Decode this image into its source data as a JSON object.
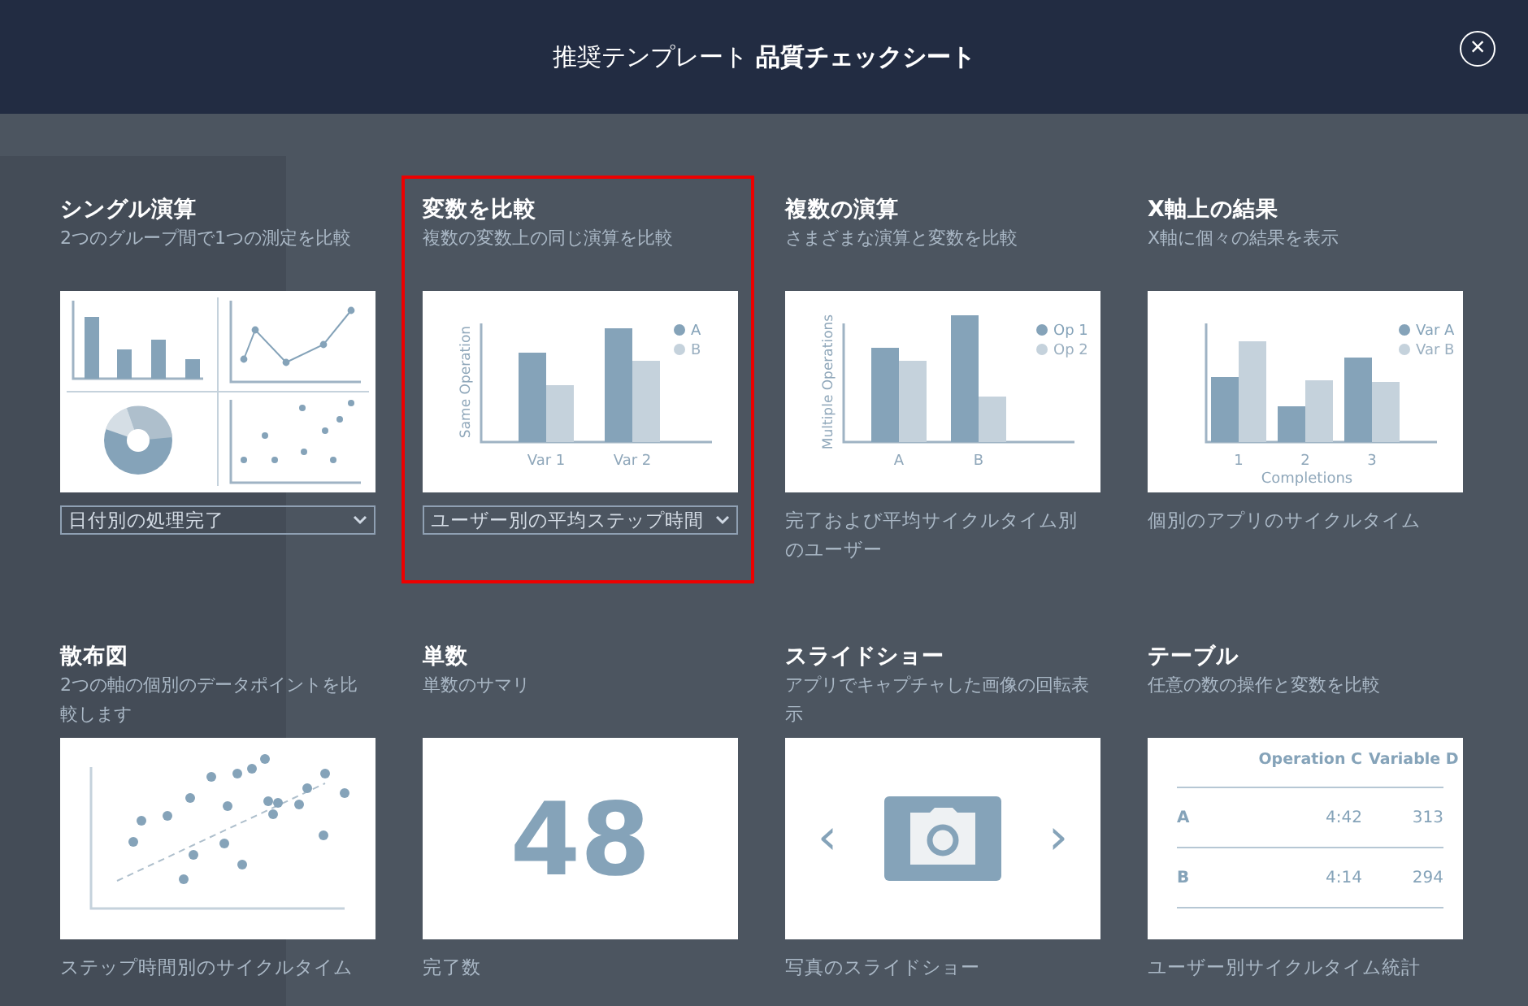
{
  "dialog": {
    "title": "推奨テンプレート **品質チェックシート**",
    "close": "×"
  },
  "templates": [
    {
      "title": "シングル演算",
      "description": "2つのグループ間で1つの測定を比較",
      "selected": false,
      "preview": {
        "kind": "quad"
      },
      "footer": {
        "kind": "dropdown",
        "text": "日付別の処理完了"
      }
    },
    {
      "title": "変数を比較",
      "description": "複数の変数上の同じ演算を比較",
      "selected": true,
      "preview": {
        "kind": "grouped-bar",
        "ylabel": "Same Operation",
        "legend": [
          "A",
          "B"
        ],
        "categories": [
          "Var 1",
          "Var 2"
        ]
      },
      "footer": {
        "kind": "dropdown",
        "text": "ユーザー別の平均ステップ時間"
      }
    },
    {
      "title": "複数の演算",
      "description": "さまざまな演算と変数を比較",
      "selected": false,
      "preview": {
        "kind": "grouped-bar",
        "ylabel": "Multiple Operations",
        "legend": [
          "Op 1",
          "Op 2"
        ],
        "categories": [
          "A",
          "B"
        ]
      },
      "footer": {
        "kind": "caption",
        "text": "完了および平均サイクルタイム別のユーザー"
      }
    },
    {
      "title": "X軸上の結果",
      "description": "X軸に個々の結果を表示",
      "selected": false,
      "preview": {
        "kind": "grouped-bar",
        "xlabel": "Completions",
        "legend": [
          "Var A",
          "Var B"
        ],
        "categories": [
          "1",
          "2",
          "3"
        ]
      },
      "footer": {
        "kind": "caption",
        "text": "個別のアプリのサイクルタイム"
      }
    },
    {
      "title": "散布図",
      "description": "2つの軸の個別のデータポイントを比較します",
      "selected": false,
      "preview": {
        "kind": "scatter"
      },
      "footer": {
        "kind": "caption",
        "text": "ステップ時間別のサイクルタイム"
      }
    },
    {
      "title": "単数",
      "description": "単数のサマリ",
      "selected": false,
      "preview": {
        "kind": "number",
        "value": "48"
      },
      "footer": {
        "kind": "caption",
        "text": "完了数"
      }
    },
    {
      "title": "スライドショー",
      "description": "アプリでキャプチャした画像の回転表示",
      "selected": false,
      "preview": {
        "kind": "slideshow",
        "prev": "‹",
        "next": "›"
      },
      "footer": {
        "kind": "caption",
        "text": "写真のスライドショー"
      }
    },
    {
      "title": "テーブル",
      "description": "任意の数の操作と変数を比較",
      "selected": false,
      "preview": {
        "kind": "table",
        "columns": [
          "",
          "Operation C",
          "Variable D"
        ],
        "rows": [
          [
            "A",
            "4:42",
            "313"
          ],
          [
            "B",
            "4:14",
            "294"
          ]
        ]
      },
      "footer": {
        "kind": "caption",
        "text": "ユーザー別サイクルタイム統計"
      }
    }
  ]
}
